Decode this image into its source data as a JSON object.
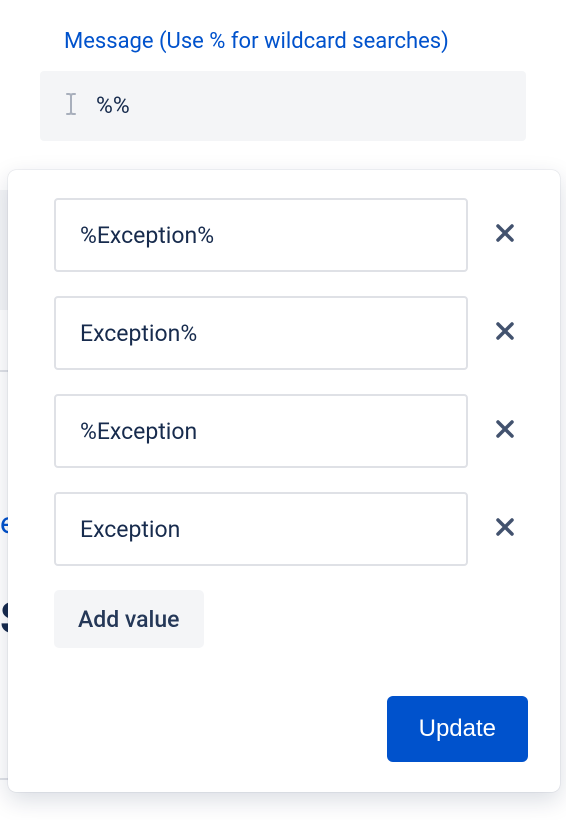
{
  "header": {
    "label": "Message (Use % for wildcard searches)",
    "search_value": "%%"
  },
  "popover": {
    "values": [
      {
        "text": "%Exception%"
      },
      {
        "text": "Exception%"
      },
      {
        "text": "%Exception"
      },
      {
        "text": "Exception"
      }
    ],
    "add_value_label": "Add value",
    "update_label": "Update"
  },
  "bg": {
    "artifact3": "e",
    "artifact4": "S"
  }
}
